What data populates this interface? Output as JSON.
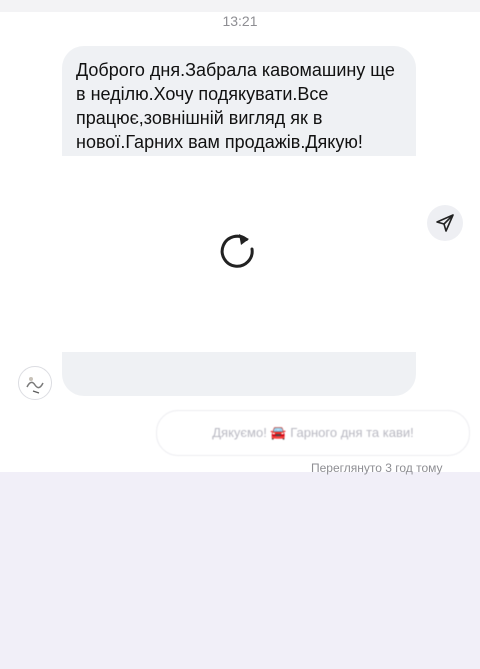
{
  "conversation": {
    "timestamp": "13:21",
    "message": {
      "text": "Доброго дня.Забрала кавомашину ще в неділю.Хочу подякувати.Все працює,зовнішній вигляд як в нової.Гарних вам продажів.Дякую!",
      "media_state": "reload-icon"
    },
    "reply": {
      "text": "Дякуємо! 🚘 Гарного дня та кави!"
    },
    "seen_status": "Переглянуто 3 год тому"
  },
  "icons": {
    "share": "send-icon",
    "reload": "reload-icon",
    "avatar": "avatar"
  }
}
